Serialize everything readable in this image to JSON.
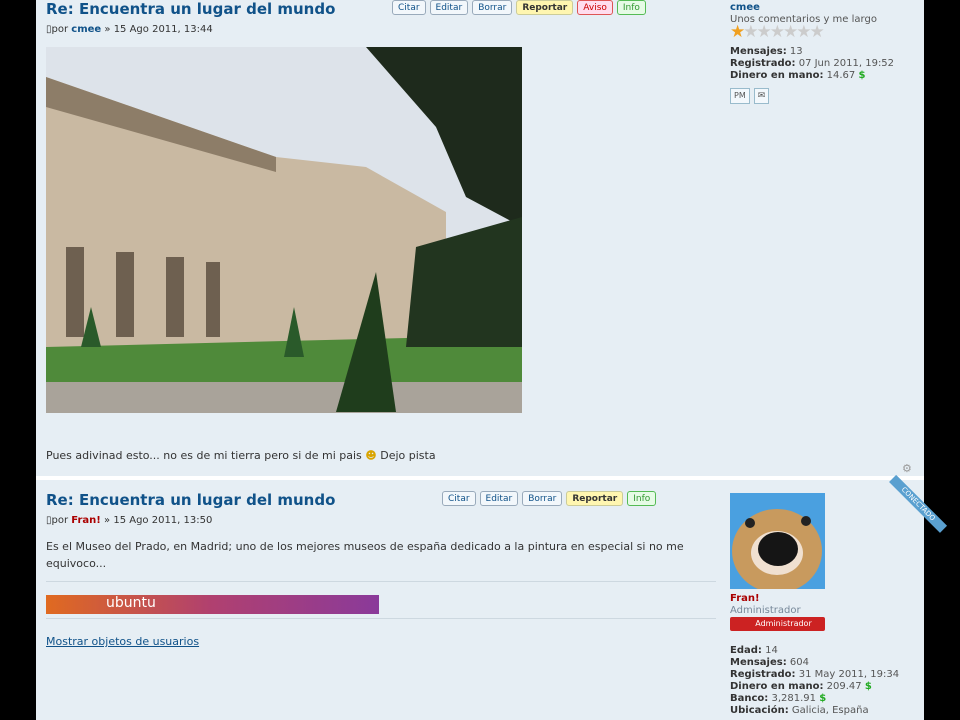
{
  "posts": [
    {
      "title": "Re: Encuentra un lugar del mundo",
      "by": "por",
      "author": "cmee",
      "date": "» 15 Ago 2011, 13:44",
      "buttons": [
        "Citar",
        "Editar",
        "Borrar",
        "Reportar",
        "Aviso",
        "Info"
      ],
      "text": "Pues adivinad esto... no es de mi tierra pero si de mi pais",
      "text_after": "Dejo pista",
      "profile": {
        "name": "cmee",
        "rank": "Unos comentarios y me largo",
        "stars": 1,
        "stars_total": 7,
        "fields": [
          {
            "label": "Mensajes:",
            "value": "13"
          },
          {
            "label": "Registrado:",
            "value": "07 Jun 2011, 19:52"
          },
          {
            "label": "Dinero en mano:",
            "value": "14.67",
            "money": true
          }
        ],
        "contact_icons": [
          "pm-icon",
          "email-icon"
        ],
        "pm_label": "PM"
      }
    },
    {
      "title": "Re: Encuentra un lugar del mundo",
      "by": "por",
      "author": "Fran!",
      "date": "» 15 Ago 2011, 13:50",
      "buttons": [
        "Citar",
        "Editar",
        "Borrar",
        "Reportar",
        "Info"
      ],
      "text": "Es el Museo del Prado, en Madrid; uno de los mejores museos de españa dedicado a la pintura en especial si no me equivoco...",
      "signature_label": "ubuntu",
      "show_items": "Mostrar objetos de usuarios",
      "profile": {
        "name": "Fran!",
        "rank": "Administrador",
        "badge": "Administrador",
        "online": "CONECTADO",
        "fields": [
          {
            "label": "Edad:",
            "value": "14"
          },
          {
            "label": "Mensajes:",
            "value": "604"
          },
          {
            "label": "Registrado:",
            "value": "31 May 2011, 19:34"
          },
          {
            "label": "Dinero en mano:",
            "value": "209.47",
            "money": true
          },
          {
            "label": "Banco:",
            "value": "3,281.91",
            "money": true
          },
          {
            "label": "Ubicación:",
            "value": "Galicia, España"
          }
        ]
      }
    }
  ],
  "currency_symbol": "$"
}
